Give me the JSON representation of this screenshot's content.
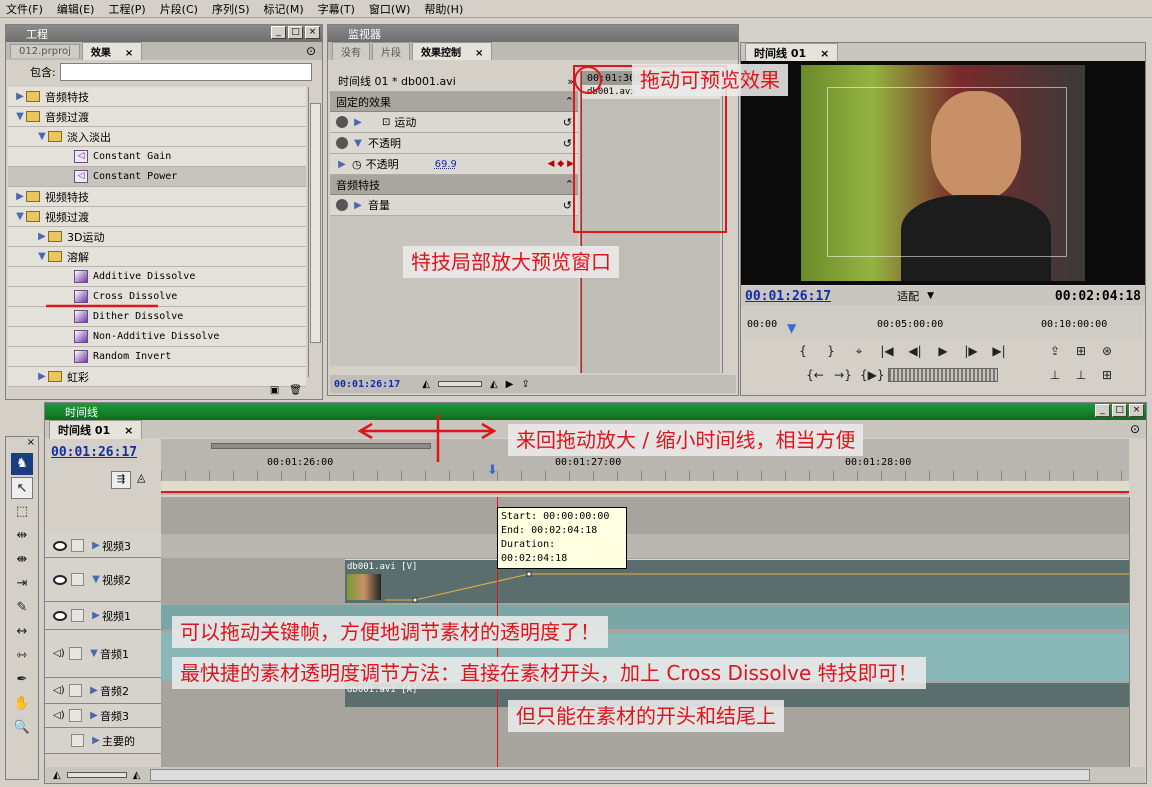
{
  "menu": [
    "文件(F)",
    "编辑(E)",
    "工程(P)",
    "片段(C)",
    "序列(S)",
    "标记(M)",
    "字幕(T)",
    "窗口(W)",
    "帮助(H)"
  ],
  "project_panel": {
    "title": "工程",
    "tabs": [
      "012.prproj",
      "效果"
    ],
    "contains_label": "包含:",
    "tree": [
      {
        "label": "音频特技",
        "type": "folder",
        "level": 0,
        "open": false
      },
      {
        "label": "音频过渡",
        "type": "folder",
        "level": 0,
        "open": true
      },
      {
        "label": "淡入淡出",
        "type": "folder",
        "level": 1,
        "open": true
      },
      {
        "label": "Constant Gain",
        "type": "audio",
        "level": 2
      },
      {
        "label": "Constant Power",
        "type": "audio",
        "level": 2,
        "selected": true
      },
      {
        "label": "视频特技",
        "type": "folder",
        "level": 0,
        "open": false
      },
      {
        "label": "视频过渡",
        "type": "folder",
        "level": 0,
        "open": true
      },
      {
        "label": "3D运动",
        "type": "folder",
        "level": 1,
        "open": false
      },
      {
        "label": "溶解",
        "type": "folder",
        "level": 1,
        "open": true
      },
      {
        "label": "Additive Dissolve",
        "type": "fx",
        "level": 2
      },
      {
        "label": "Cross Dissolve",
        "type": "fx",
        "level": 2
      },
      {
        "label": "Dither Dissolve",
        "type": "fx",
        "level": 2
      },
      {
        "label": "Non-Additive Dissolve",
        "type": "fx",
        "level": 2
      },
      {
        "label": "Random Invert",
        "type": "fx",
        "level": 2
      },
      {
        "label": "虹彩",
        "type": "folder",
        "level": 1,
        "open": false
      }
    ]
  },
  "monitor_panel": {
    "title": "监视器",
    "tabs": [
      "没有",
      "片段",
      "效果控制"
    ],
    "source": "时间线 01 * db001.avi",
    "clip_time": "00:01:30:00",
    "clip_name": "db001.avi",
    "fixed_effects": "固定的效果",
    "motion": "运动",
    "opacity": "不透明",
    "opacity_sub": "不透明",
    "opacity_value": "69.9",
    "audio_fx": "音频特技",
    "volume": "音量",
    "timecode": "00:01:26:17"
  },
  "program_monitor": {
    "tab": "时间线 01",
    "current": "00:01:26:17",
    "fit": "适配",
    "duration": "00:02:04:18",
    "ruler": [
      "00:00",
      "00:05:00:00",
      "00:10:00:00"
    ]
  },
  "timeline": {
    "title": "时间线",
    "tab": "时间线 01",
    "timecode": "00:01:26:17",
    "ruler": [
      "00:01:26:00",
      "00:01:27:00",
      "00:01:28:00"
    ],
    "tooltip": {
      "start": "Start: 00:00:00:00",
      "end": "End: 00:02:04:18",
      "duration": "Duration: 00:02:04:18"
    },
    "tracks": [
      {
        "name": "视频3",
        "kind": "video"
      },
      {
        "name": "视频2",
        "kind": "video"
      },
      {
        "name": "视频1",
        "kind": "video"
      },
      {
        "name": "音频1",
        "kind": "audio"
      },
      {
        "name": "音频2",
        "kind": "audio"
      },
      {
        "name": "音频3",
        "kind": "audio"
      },
      {
        "name": "主要的",
        "kind": "master"
      }
    ],
    "clip_v": "db001.avi [V]",
    "clip_a": "db001.avi [A]"
  },
  "annotations": {
    "drag_preview": "拖动可预览效果",
    "zoom_window": "特技局部放大预览窗口",
    "zoom_timeline": "来回拖动放大 / 缩小时间线，相当方便",
    "keyframe": "可以拖动关键帧，方便地调节素材的透明度了！",
    "fastest": "最快捷的素材透明度调节方法：直接在素材开头，加上 Cross Dissolve 特技即可！",
    "only": "但只能在素材的开头和结尾上"
  },
  "colors": {
    "accent_red": "#e0141b",
    "timecode_blue": "#102da8",
    "timeline_green": "#1f9a3a"
  }
}
